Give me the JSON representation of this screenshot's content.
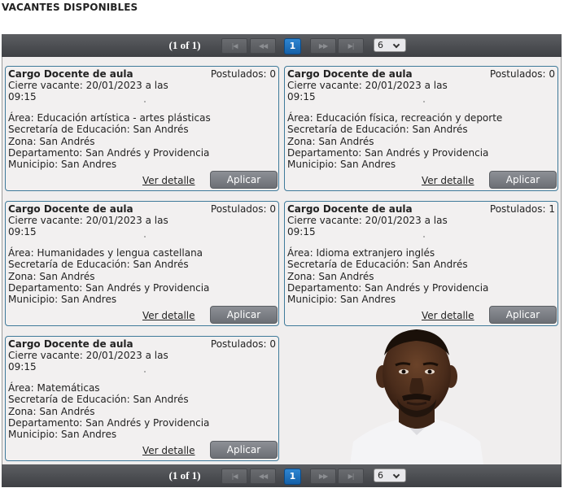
{
  "page": {
    "title": "VACANTES DISPONIBLES"
  },
  "paginator": {
    "status": "(1 of 1)",
    "first_icon": "first-page-icon",
    "prev_icon": "prev-page-icon",
    "next_icon": "next-page-icon",
    "last_icon": "last-page-icon",
    "first_glyph": "|◀",
    "prev_glyph": "◀◀",
    "next_glyph": "▶▶",
    "last_glyph": "▶|",
    "current_page": "1",
    "rows_per_page": "6"
  },
  "cards": [
    {
      "title": "Cargo Docente de aula",
      "postulados": "Postulados: 0",
      "cierre": "Cierre vacante: 20/01/2023 a las 09:15",
      "area": "Área: Educación artística - artes plásticas",
      "secretaria": "Secretaría de Educación: San Andrés",
      "zona": "Zona: San Andrés",
      "departamento": "Departamento: San Andrés y Providencia",
      "municipio": "Municipio: San Andres",
      "detalle_label": "Ver detalle",
      "aplicar_label": "Aplicar"
    },
    {
      "title": "Cargo Docente de aula",
      "postulados": "Postulados: 0",
      "cierre": "Cierre vacante: 20/01/2023 a las 09:15",
      "area": "Área: Educación física, recreación y deporte",
      "secretaria": "Secretaría de Educación: San Andrés",
      "zona": "Zona: San Andrés",
      "departamento": "Departamento: San Andrés y Providencia",
      "municipio": "Municipio: San Andres",
      "detalle_label": "Ver detalle",
      "aplicar_label": "Aplicar"
    },
    {
      "title": "Cargo Docente de aula",
      "postulados": "Postulados: 0",
      "cierre": "Cierre vacante: 20/01/2023 a las 09:15",
      "area": "Área: Humanidades y lengua castellana",
      "secretaria": "Secretaría de Educación: San Andrés",
      "zona": "Zona: San Andrés",
      "departamento": "Departamento: San Andrés y Providencia",
      "municipio": "Municipio: San Andres",
      "detalle_label": "Ver detalle",
      "aplicar_label": "Aplicar"
    },
    {
      "title": "Cargo Docente de aula",
      "postulados": "Postulados: 1",
      "cierre": "Cierre vacante: 20/01/2023 a las 09:15",
      "area": "Área: Idioma extranjero inglés",
      "secretaria": "Secretaría de Educación: San Andrés",
      "zona": "Zona: San Andrés",
      "departamento": "Departamento: San Andrés y Providencia",
      "municipio": "Municipio: San Andres",
      "detalle_label": "Ver detalle",
      "aplicar_label": "Aplicar"
    },
    {
      "title": "Cargo Docente de aula",
      "postulados": "Postulados: 0",
      "cierre": "Cierre vacante: 20/01/2023 a las 09:15",
      "area": "Área: Matemáticas",
      "secretaria": "Secretaría de Educación: San Andrés",
      "zona": "Zona: San Andrés",
      "departamento": "Departamento: San Andrés y Providencia",
      "municipio": "Municipio: San Andres",
      "detalle_label": "Ver detalle",
      "aplicar_label": "Aplicar"
    }
  ],
  "photo": {
    "icon": "person-photo"
  },
  "colors": {
    "paginator_bg": "#4a4c50",
    "page_active": "#1f73c0",
    "card_border": "#3f7a9a",
    "button_bg": "#7c7f85",
    "panel_bg": "#f0eeee"
  }
}
